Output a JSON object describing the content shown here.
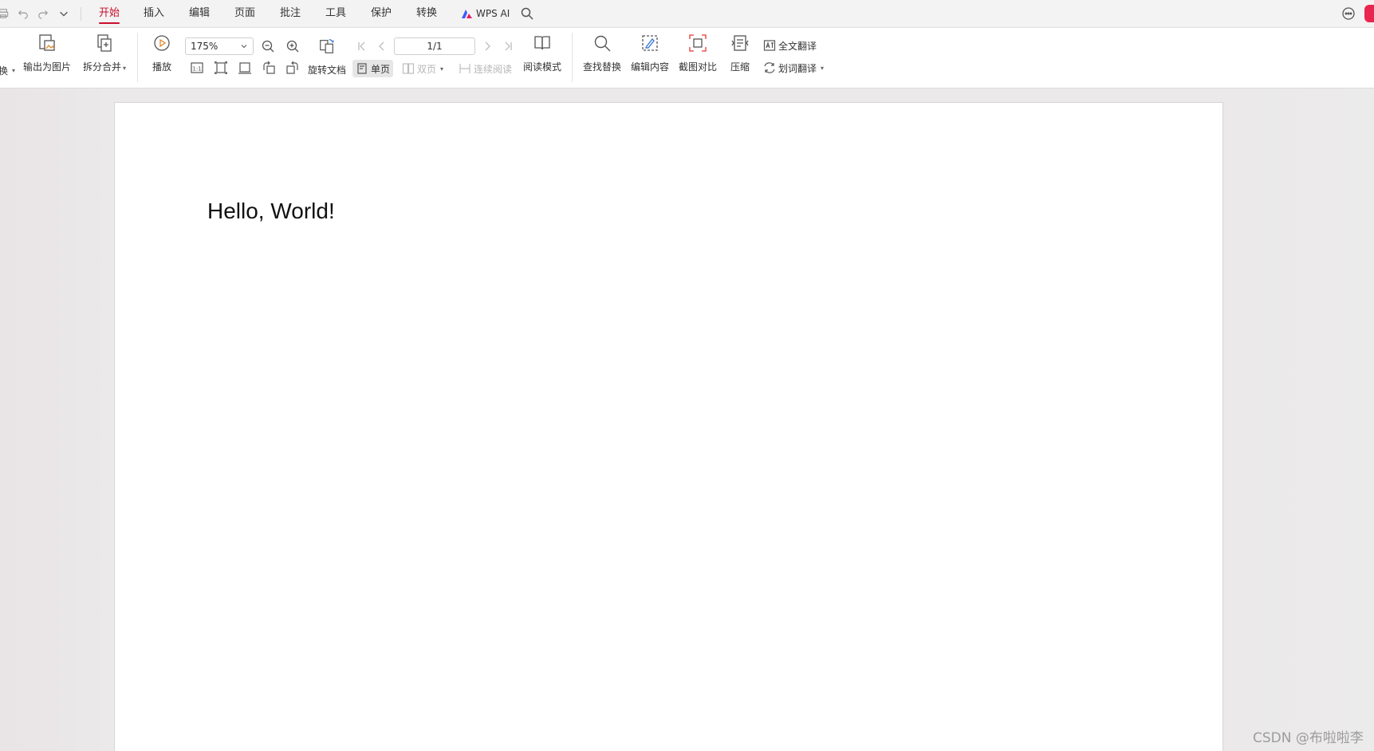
{
  "quick_access": {
    "icons": [
      "print-icon",
      "undo-icon",
      "redo-icon",
      "more-chevron-icon"
    ]
  },
  "tabs": [
    {
      "label": "开始",
      "active": true
    },
    {
      "label": "插入"
    },
    {
      "label": "编辑"
    },
    {
      "label": "页面"
    },
    {
      "label": "批注"
    },
    {
      "label": "工具"
    },
    {
      "label": "保护"
    },
    {
      "label": "转换"
    }
  ],
  "wps_ai": {
    "label": "WPS AI"
  },
  "ribbon": {
    "partial_label": "换",
    "export_image": "输出为图片",
    "split_merge": "拆分合并",
    "play": "播放",
    "zoom_value": "175%",
    "rotate_doc": "旋转文档",
    "single_page": "单页",
    "double_page": "双页",
    "continuous_read": "连续阅读",
    "page_value": "1/1",
    "reading_mode": "阅读模式",
    "find_replace": "查找替换",
    "edit_content": "编辑内容",
    "screenshot_compare": "截图对比",
    "compress": "压缩",
    "full_translate": "全文翻译",
    "word_translate": "划词翻译"
  },
  "document": {
    "text": "Hello, World!"
  },
  "watermark": "CSDN @布啦啦李",
  "colors": {
    "accent": "#c8102e",
    "page": "#ffffff",
    "canvas": "#ebe9ea"
  }
}
